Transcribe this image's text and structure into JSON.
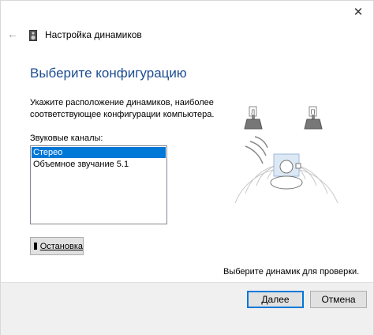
{
  "window": {
    "close_glyph": "✕",
    "title": "Настройка динамиков"
  },
  "page": {
    "heading": "Выберите конфигурацию",
    "description": "Укажите расположение динамиков, наиболее соответствующее конфигурации компьютера.",
    "channels_label": "Звуковые каналы:",
    "channels": [
      {
        "label": "Стерео",
        "selected": true
      },
      {
        "label": "Объемное звучание 5.1",
        "selected": false
      }
    ],
    "stop_button": "Остановка",
    "test_hint": "Выберите динамик для проверки.",
    "speaker_left_letter": "Л",
    "speaker_right_letter": "П"
  },
  "footer": {
    "next_button": "Далее",
    "cancel_button": "Отмена"
  },
  "colors": {
    "heading": "#1e4d91",
    "selection": "#0078d7",
    "footer_bg": "#f0f0f0"
  },
  "icons": {
    "back": "back-arrow-icon",
    "speaker": "speaker-icon",
    "stop": "stop-square-icon",
    "close": "close-icon"
  }
}
